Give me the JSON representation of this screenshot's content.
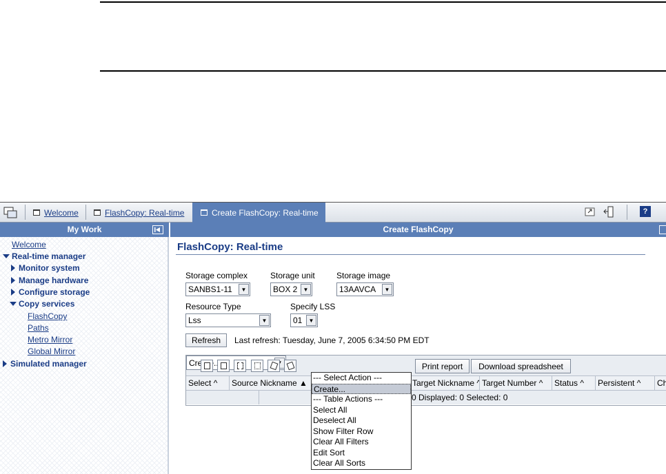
{
  "tabs": [
    {
      "label": "Welcome"
    },
    {
      "label": "FlashCopy: Real-time"
    },
    {
      "label": "Create FlashCopy: Real-time"
    }
  ],
  "sidebar": {
    "header": "My Work",
    "items": {
      "welcome": "Welcome",
      "realtime": "Real-time manager",
      "monitor": "Monitor system",
      "hardware": "Manage hardware",
      "configure": "Configure storage",
      "copy": "Copy services",
      "flashcopy": "FlashCopy",
      "paths": "Paths",
      "metro": "Metro Mirror",
      "global": "Global Mirror",
      "simulated": "Simulated manager"
    }
  },
  "main": {
    "header": "Create FlashCopy",
    "title": "FlashCopy: Real-time",
    "storage_complex": {
      "label": "Storage complex",
      "value": "SANBS1-11"
    },
    "storage_unit": {
      "label": "Storage unit",
      "value": "BOX 2"
    },
    "storage_image": {
      "label": "Storage image",
      "value": "13AAVCA"
    },
    "resource_type": {
      "label": "Resource Type",
      "value": "Lss"
    },
    "specify_lss": {
      "label": "Specify LSS",
      "value": "01"
    },
    "refresh_label": "Refresh",
    "last_refresh": "Last refresh: Tuesday, June 7, 2005 6:34:50 PM EDT"
  },
  "table": {
    "action_select": "Create...",
    "print_label": "Print report",
    "download_label": "Download spreadsheet",
    "columns": [
      "Select",
      "Source Nickname",
      "Target Nickname",
      "Target Number",
      "Status",
      "Persistent",
      "Ch"
    ],
    "status_row": "0   Displayed: 0   Selected: 0"
  },
  "dropdown": {
    "items": [
      "--- Select Action ---",
      "Create...",
      "--- Table Actions ---",
      "Select All",
      "Deselect All",
      "Show Filter Row",
      "Clear All Filters",
      "Edit Sort",
      "Clear All Sorts"
    ],
    "highlighted_index": 1
  }
}
